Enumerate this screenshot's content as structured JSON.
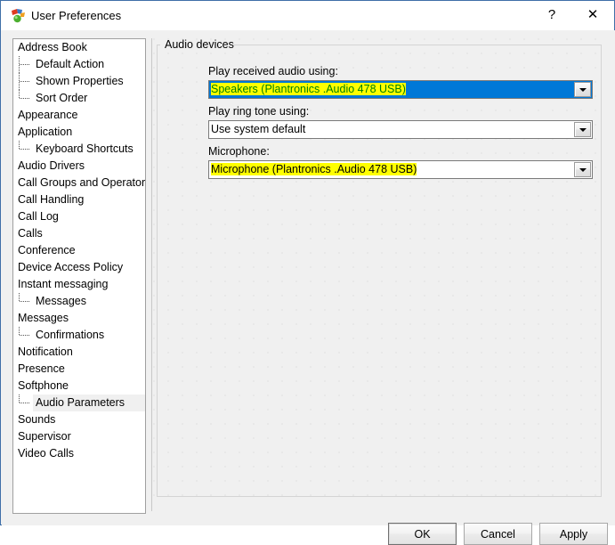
{
  "window": {
    "title": "User Preferences",
    "icon": "app-icon",
    "help_label": "?",
    "close_label": "✕"
  },
  "sidebar": {
    "items": [
      {
        "label": "Address Book",
        "level": 0,
        "selected": false,
        "last_child": false
      },
      {
        "label": "Default Action",
        "level": 1,
        "selected": false,
        "last_child": false
      },
      {
        "label": "Shown Properties",
        "level": 1,
        "selected": false,
        "last_child": false
      },
      {
        "label": "Sort Order",
        "level": 1,
        "selected": false,
        "last_child": true
      },
      {
        "label": "Appearance",
        "level": 0,
        "selected": false,
        "last_child": false
      },
      {
        "label": "Application",
        "level": 0,
        "selected": false,
        "last_child": false
      },
      {
        "label": "Keyboard Shortcuts",
        "level": 1,
        "selected": false,
        "last_child": true
      },
      {
        "label": "Audio Drivers",
        "level": 0,
        "selected": false,
        "last_child": false
      },
      {
        "label": "Call Groups and Operators",
        "level": 0,
        "selected": false,
        "last_child": false
      },
      {
        "label": "Call Handling",
        "level": 0,
        "selected": false,
        "last_child": false
      },
      {
        "label": "Call Log",
        "level": 0,
        "selected": false,
        "last_child": false
      },
      {
        "label": "Calls",
        "level": 0,
        "selected": false,
        "last_child": false
      },
      {
        "label": "Conference",
        "level": 0,
        "selected": false,
        "last_child": false
      },
      {
        "label": "Device Access Policy",
        "level": 0,
        "selected": false,
        "last_child": false
      },
      {
        "label": "Instant messaging",
        "level": 0,
        "selected": false,
        "last_child": false
      },
      {
        "label": "Messages",
        "level": 1,
        "selected": false,
        "last_child": true
      },
      {
        "label": "Messages",
        "level": 0,
        "selected": false,
        "last_child": false
      },
      {
        "label": "Confirmations",
        "level": 1,
        "selected": false,
        "last_child": true
      },
      {
        "label": "Notification",
        "level": 0,
        "selected": false,
        "last_child": false
      },
      {
        "label": "Presence",
        "level": 0,
        "selected": false,
        "last_child": false
      },
      {
        "label": "Softphone",
        "level": 0,
        "selected": false,
        "last_child": false
      },
      {
        "label": "Audio Parameters",
        "level": 1,
        "selected": true,
        "last_child": true
      },
      {
        "label": "Sounds",
        "level": 0,
        "selected": false,
        "last_child": false
      },
      {
        "label": "Supervisor",
        "level": 0,
        "selected": false,
        "last_child": false
      },
      {
        "label": "Video Calls",
        "level": 0,
        "selected": false,
        "last_child": false
      }
    ]
  },
  "main": {
    "group_title": "Audio devices",
    "fields": [
      {
        "label": "Play received audio using:",
        "value": "Speakers (Plantronics .Audio 478 USB)",
        "focused": true,
        "highlighted": true
      },
      {
        "label": "Play ring tone using:",
        "value": "Use system default",
        "focused": false,
        "highlighted": false
      },
      {
        "label": "Microphone:",
        "value": "Microphone (Plantronics .Audio 478 USB)",
        "focused": false,
        "highlighted": true
      }
    ]
  },
  "footer": {
    "ok_label": "OK",
    "cancel_label": "Cancel",
    "apply_label": "Apply"
  },
  "colors": {
    "selection_blue": "#0078d7",
    "highlight_yellow": "#ffff00",
    "highlight_text_green": "#008000",
    "dialog_gray": "#f0f0f0",
    "window_border": "#3f6fa8"
  }
}
